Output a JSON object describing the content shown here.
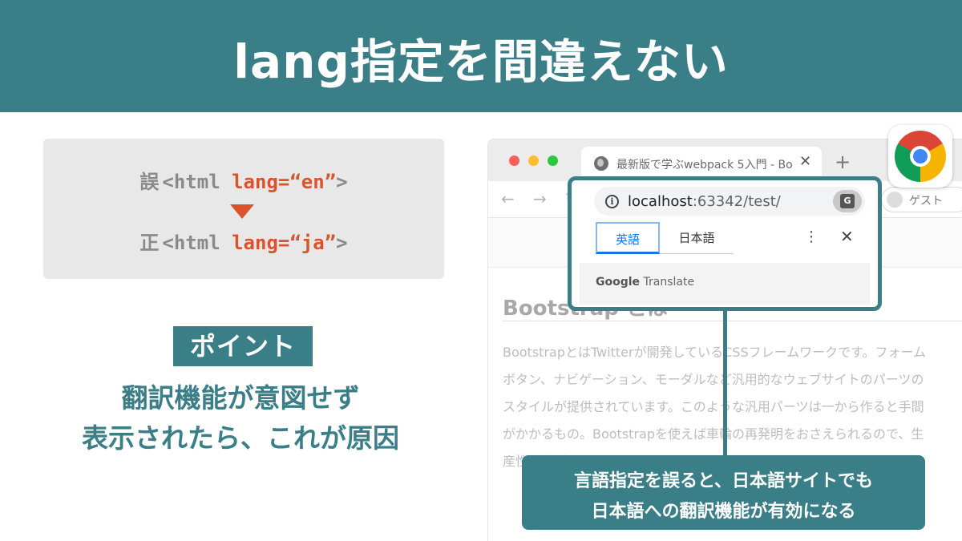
{
  "header": {
    "title": "lang指定を間違えない"
  },
  "code_example": {
    "wrong_mark": "誤",
    "wrong_prefix": "<html ",
    "wrong_attr": "lang=“en”",
    "wrong_suffix": ">",
    "right_mark": "正",
    "right_prefix": "<html ",
    "right_attr": "lang=“ja”",
    "right_suffix": ">"
  },
  "point": {
    "badge": "ポイント",
    "line1": "翻訳機能が意図せず",
    "line2": "表示されたら、これが原因"
  },
  "browser": {
    "tab_title": "最新版で学ぶwebpack 5入門 - Bo",
    "tab_close": "✕",
    "new_tab": "+",
    "guest_label": "ゲスト",
    "url_host": "localhost",
    "url_rest": ":63342/test/",
    "page_heading": "Bootstrap とは",
    "page_lines": [
      "BootstrapとはTwitterが開発しているCSSフレームワークです。フォーム",
      "ボタン、ナビゲーション、モーダルなど汎用的なウェブサイトのパーツの",
      "スタイルが提供されています。このような汎用パーツは一から作ると手間",
      "がかかるもの。Bootstrapを使えば車輪の再発明をおさえられるので、生",
      "産性も上がります。"
    ]
  },
  "translate_popup": {
    "tab_source": "英語",
    "tab_target": "日本語",
    "footer_brand": "Google",
    "footer_product": "Translate"
  },
  "callout": {
    "line1": "言語指定を誤ると、日本語サイトでも",
    "line2": "日本語への翻訳機能が有効になる"
  },
  "colors": {
    "accent": "#3a7e88",
    "highlight": "#d9542b"
  }
}
